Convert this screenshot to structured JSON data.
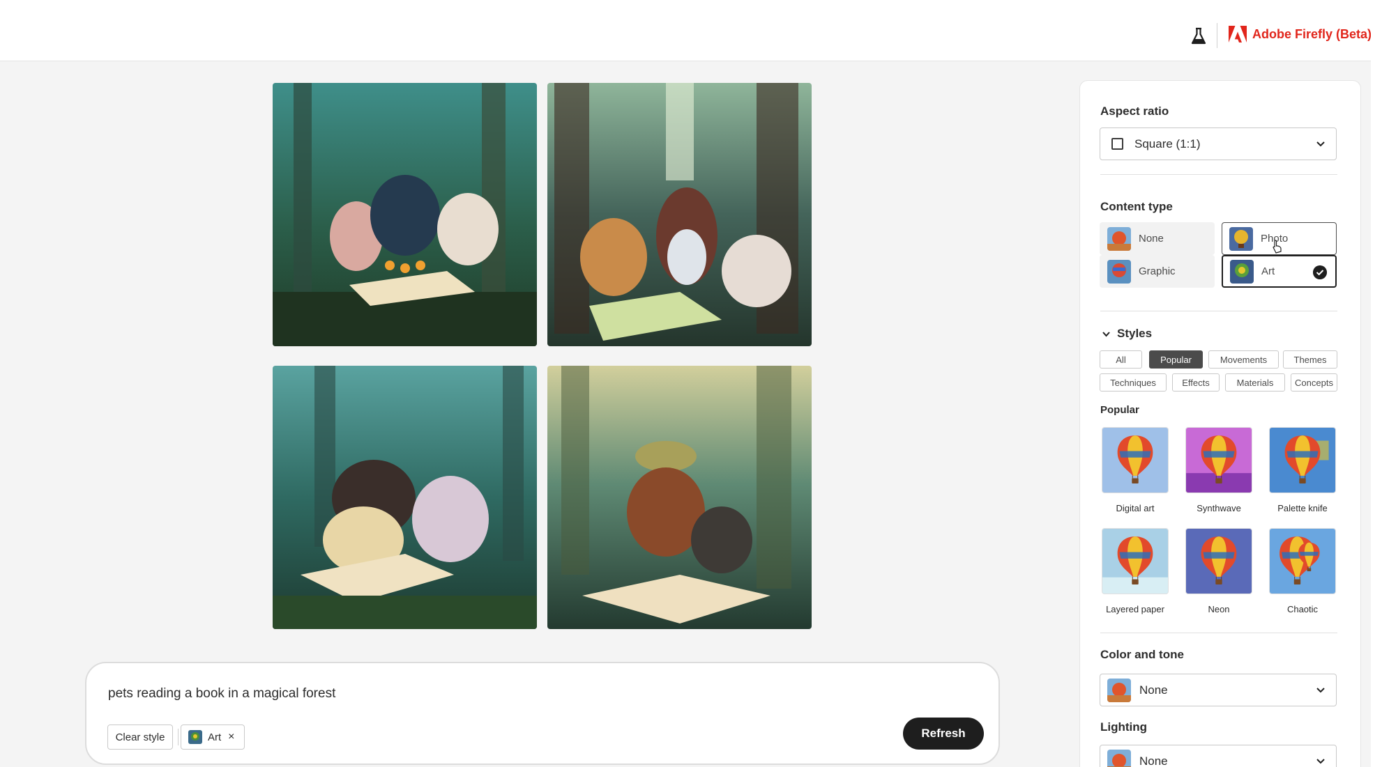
{
  "header": {
    "brand_name": "Adobe Firefly (Beta)",
    "lab_icon": "beaker-icon",
    "brand_icon": "adobe-logo-icon",
    "brand_color": "#e1251b"
  },
  "gallery": {
    "images": [
      {
        "description_icon": "generated-image-1"
      },
      {
        "description_icon": "generated-image-2"
      },
      {
        "description_icon": "generated-image-3"
      },
      {
        "description_icon": "generated-image-4"
      }
    ]
  },
  "prompt": {
    "text": "pets reading a book in a magical forest",
    "clear_style_label": "Clear style",
    "applied_style_chip": "Art",
    "remove_icon": "close-icon",
    "refresh_label": "Refresh"
  },
  "panel": {
    "aspect_ratio": {
      "heading": "Aspect ratio",
      "selected": "Square (1:1)"
    },
    "content_type": {
      "heading": "Content type",
      "options": [
        {
          "label": "None",
          "state": "default"
        },
        {
          "label": "Photo",
          "state": "hover"
        },
        {
          "label": "Graphic",
          "state": "default"
        },
        {
          "label": "Art",
          "state": "selected"
        }
      ]
    },
    "styles": {
      "heading": "Styles",
      "filters": [
        "All",
        "Popular",
        "Movements",
        "Themes",
        "Techniques",
        "Effects",
        "Materials",
        "Concepts"
      ],
      "active_filter": "Popular",
      "section_heading": "Popular",
      "items": [
        {
          "label": "Digital art"
        },
        {
          "label": "Synthwave"
        },
        {
          "label": "Palette knife"
        },
        {
          "label": "Layered paper"
        },
        {
          "label": "Neon"
        },
        {
          "label": "Chaotic"
        }
      ]
    },
    "color_and_tone": {
      "heading": "Color and tone",
      "selected": "None"
    },
    "lighting": {
      "heading": "Lighting",
      "selected": "None"
    }
  }
}
